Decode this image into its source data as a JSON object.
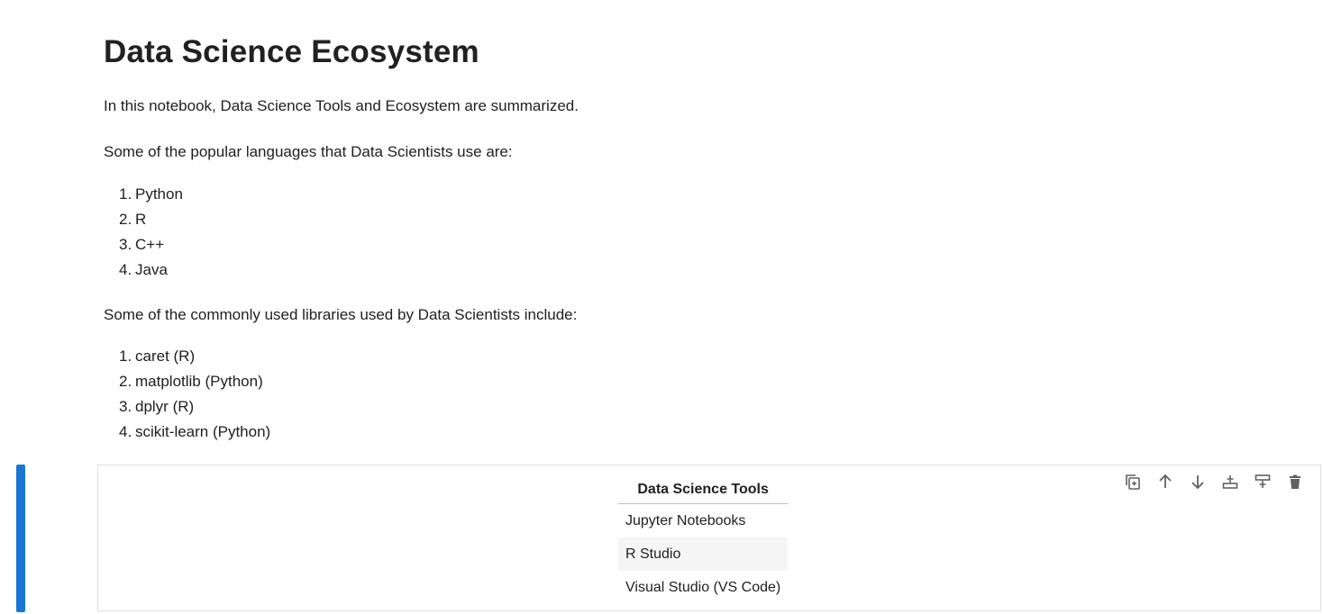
{
  "markdown": {
    "title": "Data Science Ecosystem",
    "intro": "In this notebook, Data Science Tools and Ecosystem are summarized.",
    "languages_heading": "Some of the popular languages that Data Scientists use are:",
    "languages": [
      {
        "num": "1.",
        "label": "Python"
      },
      {
        "num": "2.",
        "label": "R"
      },
      {
        "num": "3.",
        "label": "C++"
      },
      {
        "num": "4.",
        "label": "Java"
      }
    ],
    "libraries_heading": "Some of the commonly used libraries used by Data Scientists include:",
    "libraries": [
      {
        "num": "1.",
        "label": "caret (R)"
      },
      {
        "num": "2.",
        "label": "matplotlib (Python)"
      },
      {
        "num": "3.",
        "label": "dplyr (R)"
      },
      {
        "num": "4.",
        "label": "scikit-learn (Python)"
      }
    ]
  },
  "tools_table": {
    "header": "Data Science Tools",
    "rows": [
      "Jupyter Notebooks",
      "R Studio",
      "Visual Studio (VS Code)"
    ]
  },
  "cell_toolbar": {
    "icons": [
      "duplicate-icon",
      "move-up-icon",
      "move-down-icon",
      "insert-above-icon",
      "insert-below-icon",
      "delete-icon"
    ]
  },
  "colors": {
    "active_cell_collapser": "#1976d2",
    "icon": "#616161"
  }
}
